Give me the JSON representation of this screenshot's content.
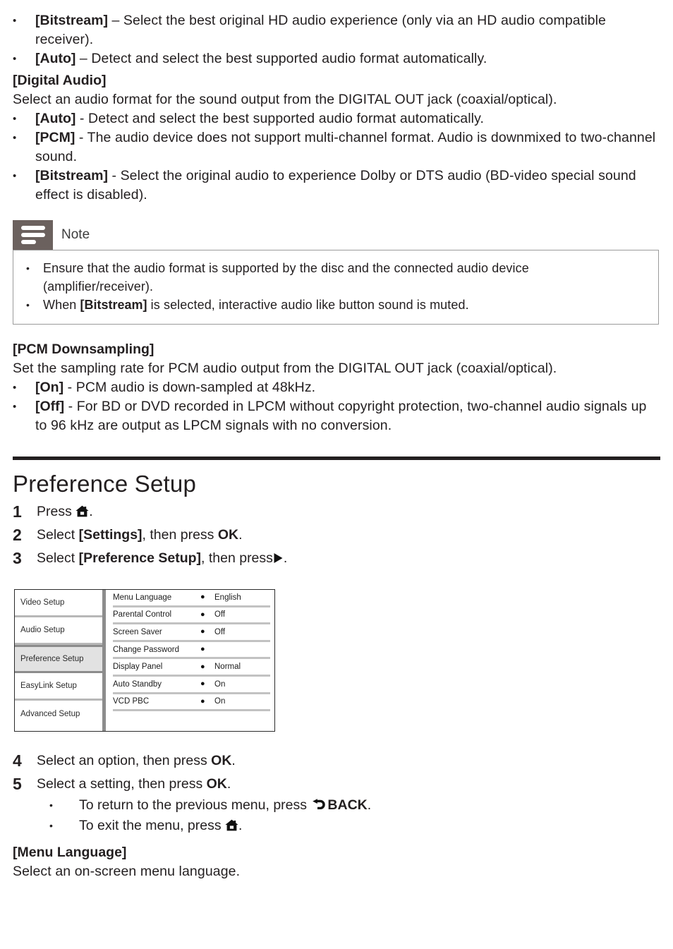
{
  "colors": {
    "note_badge": "#6b615e",
    "note_border": "#9b9b9b",
    "rule": "#231f20",
    "osd_selected_bg": "#e2e2e2",
    "osd_divider": "#8c8c8c"
  },
  "top_bullets": [
    {
      "bullet": "•",
      "term": "[Bitstream]",
      "rest": " – Select the best original HD audio experience (only via an HD audio compatible receiver)."
    },
    {
      "bullet": "•",
      "term": "[Auto]",
      "rest": " – Detect and select the best supported audio format automatically."
    }
  ],
  "digital_audio": {
    "heading": "[Digital Audio]",
    "intro": "Select an audio format for the sound output from the DIGITAL OUT jack (coaxial/optical).",
    "bullets": [
      {
        "bullet": "•",
        "term": "[Auto]",
        "rest": " - Detect and select the best supported audio format automatically."
      },
      {
        "bullet": "•",
        "term": "[PCM]",
        "rest": " - The audio device does not support multi-channel format. Audio is downmixed to two-channel sound."
      },
      {
        "bullet": "•",
        "term": "[Bitstream]",
        "rest": " - Select the original audio to experience Dolby or DTS audio (BD-video special sound effect is disabled)."
      }
    ]
  },
  "note": {
    "icon": "note-lines-icon",
    "title": "Note",
    "bullets": [
      {
        "bullet": "•",
        "pre": "Ensure that the audio format is supported by the disc and the connected audio device (amplifier/receiver).",
        "term": "",
        "post": ""
      },
      {
        "bullet": "•",
        "pre": "When ",
        "term": "[Bitstream]",
        "post": " is selected, interactive audio like button sound is muted."
      }
    ]
  },
  "pcm": {
    "heading": "[PCM Downsampling]",
    "intro": "Set the sampling rate for PCM audio output from the DIGITAL OUT jack (coaxial/optical).",
    "bullets": [
      {
        "bullet": "•",
        "term": "[On]",
        "rest": " - PCM audio is down-sampled at 48kHz."
      },
      {
        "bullet": "•",
        "term": "[Off]",
        "rest": " - For BD or DVD recorded in LPCM without copyright protection, two-channel audio signals up to 96 kHz are output as LPCM signals with no conversion."
      }
    ]
  },
  "chapter": {
    "title": "Preference Setup",
    "steps": [
      {
        "num": "1",
        "pre": "Press ",
        "icon": "home-icon",
        "term": "",
        "mid": "",
        "post": "."
      },
      {
        "num": "2",
        "pre": "Select ",
        "term": "[Settings]",
        "mid": ", then press ",
        "strong": "OK",
        "post": "."
      },
      {
        "num": "3",
        "pre": "Select ",
        "term": "[Preference Setup]",
        "mid": ", then press",
        "icon": "play-right-icon",
        "post": "."
      }
    ],
    "steps_after": [
      {
        "num": "4",
        "pre": "Select an option, then press ",
        "strong": "OK",
        "post": "."
      },
      {
        "num": "5",
        "pre": "Select a setting, then press ",
        "strong": "OK",
        "post": "."
      }
    ],
    "substeps": [
      {
        "bullet": "•",
        "pre": "To return to the previous menu, press ",
        "icon": "back-arrow-icon",
        "strong": "BACK",
        "post": "."
      },
      {
        "bullet": "•",
        "pre": "To exit the menu, press ",
        "icon": "home-icon",
        "strong": "",
        "post": "."
      }
    ]
  },
  "osd": {
    "sidebar": [
      {
        "label": "Video Setup",
        "selected": false
      },
      {
        "label": "Audio Setup",
        "selected": false
      },
      {
        "label": "Preference Setup",
        "selected": true
      },
      {
        "label": "EasyLink Setup",
        "selected": false
      },
      {
        "label": "Advanced Setup",
        "selected": false
      }
    ],
    "rows": [
      {
        "label": "Menu Language",
        "dot": "●",
        "value": "English"
      },
      {
        "label": "Parental Control",
        "dot": "●",
        "value": "Off"
      },
      {
        "label": "Screen Saver",
        "dot": "●",
        "value": "Off"
      },
      {
        "label": "Change Password",
        "dot": "●",
        "value": ""
      },
      {
        "label": "Display Panel",
        "dot": "●",
        "value": "Normal"
      },
      {
        "label": "Auto Standby",
        "dot": "●",
        "value": "On"
      },
      {
        "label": "VCD PBC",
        "dot": "●",
        "value": "On"
      }
    ]
  },
  "menu_language": {
    "heading": "[Menu Language]",
    "text": "Select an on-screen menu language."
  }
}
